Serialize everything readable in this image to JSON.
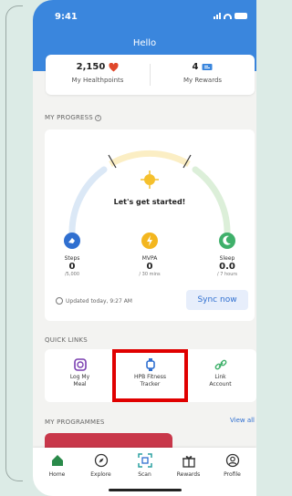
{
  "status_bar": {
    "time": "9:41"
  },
  "header": {
    "title": "Hello"
  },
  "stats": {
    "healthpoints_value": "2,150",
    "healthpoints_label": "My Healthpoints",
    "rewards_value": "4",
    "rewards_label": "My Rewards"
  },
  "progress": {
    "section_title": "MY PROGRESS",
    "headline": "Let's get started!",
    "metrics": [
      {
        "label": "Steps",
        "value": "0",
        "sub": "/5,000"
      },
      {
        "label": "MVPA",
        "value": "0",
        "sub": "/ 30 mins"
      },
      {
        "label": "Sleep",
        "value": "0.0",
        "sub": "/ 7 hours"
      }
    ],
    "updated": "Updated today, 9:27 AM",
    "sync_label": "Sync now"
  },
  "quick_links": {
    "section_title": "QUICK LINKS",
    "items": [
      {
        "label_line1": "Log My",
        "label_line2": "Meal"
      },
      {
        "label_line1": "HPB Fitness",
        "label_line2": "Tracker"
      },
      {
        "label_line1": "Link",
        "label_line2": "Account"
      }
    ]
  },
  "programmes": {
    "section_title": "MY PROGRAMMES",
    "view_all": "View all"
  },
  "nav": {
    "items": [
      {
        "label": "Home"
      },
      {
        "label": "Explore"
      },
      {
        "label": "Scan"
      },
      {
        "label": "Rewards"
      },
      {
        "label": "Profile"
      }
    ]
  },
  "colors": {
    "accent": "#3a86dd",
    "highlight": "#e00000",
    "home_active": "#2a8a4a"
  }
}
